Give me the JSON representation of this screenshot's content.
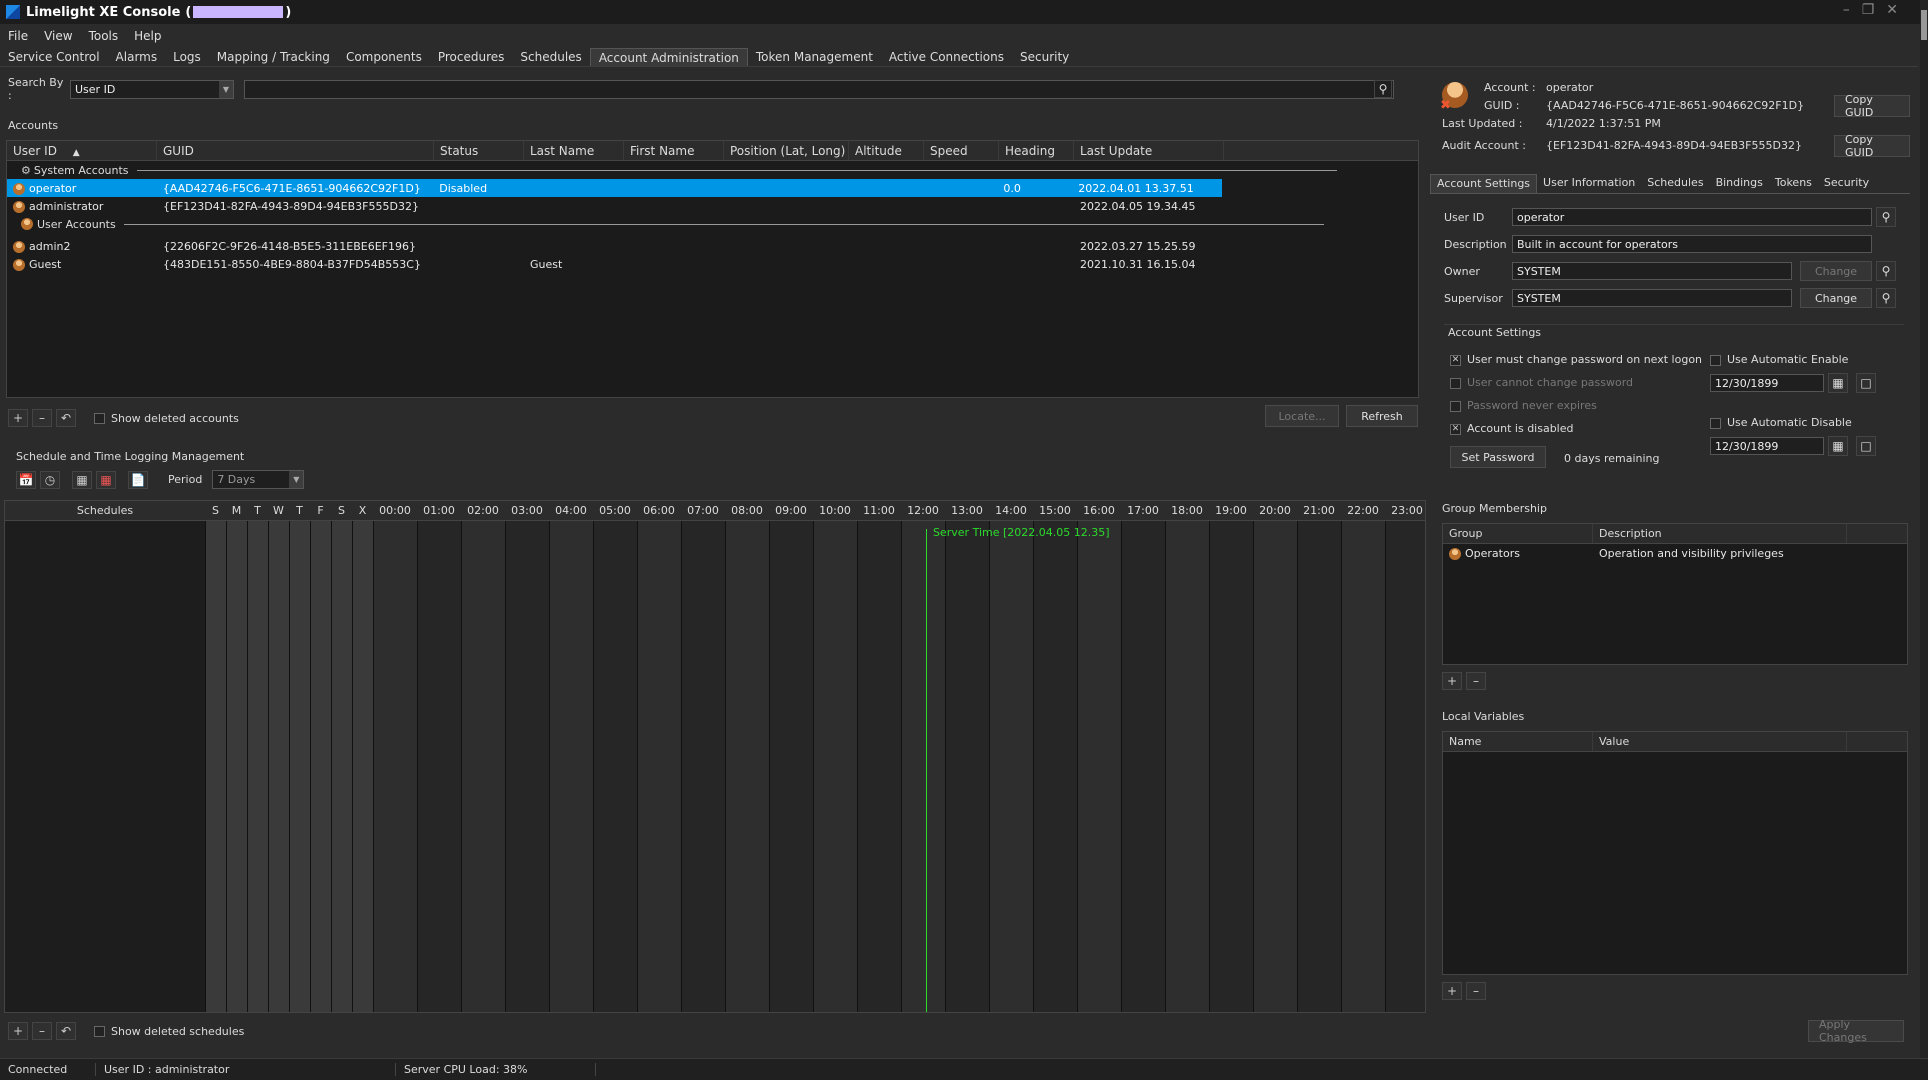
{
  "window": {
    "title": "Limelight XE Console",
    "title_suffix_open": "(",
    "title_suffix_close": ")"
  },
  "menu": [
    "File",
    "View",
    "Tools",
    "Help"
  ],
  "tabs": [
    "Service Control",
    "Alarms",
    "Logs",
    "Mapping / Tracking",
    "Components",
    "Procedures",
    "Schedules",
    "Account Administration",
    "Token Management",
    "Active Connections",
    "Security"
  ],
  "search": {
    "label": "Search By :",
    "by": "User ID",
    "query": ""
  },
  "accounts": {
    "title": "Accounts",
    "columns": [
      "User ID",
      "GUID",
      "Status",
      "Last Name",
      "First Name",
      "Position (Lat, Long)",
      "Altitude",
      "Speed",
      "Heading",
      "Last Update"
    ],
    "group_system": "System Accounts",
    "group_user": "User Accounts",
    "system_rows": [
      {
        "user_id": "operator",
        "guid": "{AAD42746-F5C6-471E-8651-904662C92F1D}",
        "status": "Disabled",
        "last_name": "",
        "heading": "0.0",
        "last_update": "2022.04.01 13.37.51"
      },
      {
        "user_id": "administrator",
        "guid": "{EF123D41-82FA-4943-89D4-94EB3F555D32}",
        "status": "",
        "last_name": "",
        "heading": "",
        "last_update": "2022.04.05 19.34.45"
      }
    ],
    "user_rows": [
      {
        "user_id": "admin2",
        "guid": "{22606F2C-9F26-4148-B5E5-311EBE6EF196}",
        "status": "",
        "last_name": "",
        "heading": "",
        "last_update": "2022.03.27 15.25.59"
      },
      {
        "user_id": "Guest",
        "guid": "{483DE151-8550-4BE9-8804-B37FD54B553C}",
        "status": "",
        "last_name": "Guest",
        "heading": "",
        "last_update": "2021.10.31 16.15.04"
      }
    ],
    "show_deleted": "Show deleted accounts",
    "locate": "Locate...",
    "refresh": "Refresh"
  },
  "schedule": {
    "title": "Schedule and Time Logging Management",
    "period_label": "Period",
    "period": "7 Days",
    "col_schedules": "Schedules",
    "days": [
      "S",
      "M",
      "T",
      "W",
      "T",
      "F",
      "S",
      "X"
    ],
    "hours": [
      "00:00",
      "01:00",
      "02:00",
      "03:00",
      "04:00",
      "05:00",
      "06:00",
      "07:00",
      "08:00",
      "09:00",
      "10:00",
      "11:00",
      "12:00",
      "13:00",
      "14:00",
      "15:00",
      "16:00",
      "17:00",
      "18:00",
      "19:00",
      "20:00",
      "21:00",
      "22:00",
      "23:00"
    ],
    "server_time": "Server Time [2022.04.05 12.35]",
    "show_deleted": "Show deleted schedules"
  },
  "detail": {
    "account_label": "Account :",
    "account": "operator",
    "guid_label": "GUID :",
    "guid": "{AAD42746-F5C6-471E-8651-904662C92F1D}",
    "last_updated_label": "Last Updated :",
    "last_updated": "4/1/2022 1:37:51 PM",
    "audit_label": "Audit Account :",
    "audit": "{EF123D41-82FA-4943-89D4-94EB3F555D32}",
    "copy_guid": "Copy GUID",
    "tabs": [
      "Account Settings",
      "User Information",
      "Schedules",
      "Bindings",
      "Tokens",
      "Security"
    ],
    "user_id_label": "User ID",
    "user_id": "operator",
    "desc_label": "Description",
    "desc": "Built in account for operators",
    "owner_label": "Owner",
    "owner": "SYSTEM",
    "supervisor_label": "Supervisor",
    "supervisor": "SYSTEM",
    "change": "Change",
    "settings_title": "Account Settings",
    "opt_must_change": "User must change password on next logon",
    "opt_cannot_change": "User cannot change password",
    "opt_never_expires": "Password never expires",
    "opt_disabled": "Account is disabled",
    "opt_auto_enable": "Use Automatic Enable",
    "opt_auto_disable": "Use Automatic Disable",
    "date_enable": "12/30/1899",
    "date_disable": "12/30/1899",
    "set_password": "Set Password",
    "days_remaining": "0 days remaining",
    "group_title": "Group Membership",
    "group_cols": [
      "Group",
      "Description"
    ],
    "groups": [
      {
        "name": "Operators",
        "desc": "Operation and visibility privileges"
      }
    ],
    "vars_title": "Local Variables",
    "vars_cols": [
      "Name",
      "Value"
    ],
    "apply": "Apply Changes"
  },
  "status": {
    "connected": "Connected",
    "user": "User ID : administrator",
    "cpu": "Server CPU Load: 38%"
  }
}
